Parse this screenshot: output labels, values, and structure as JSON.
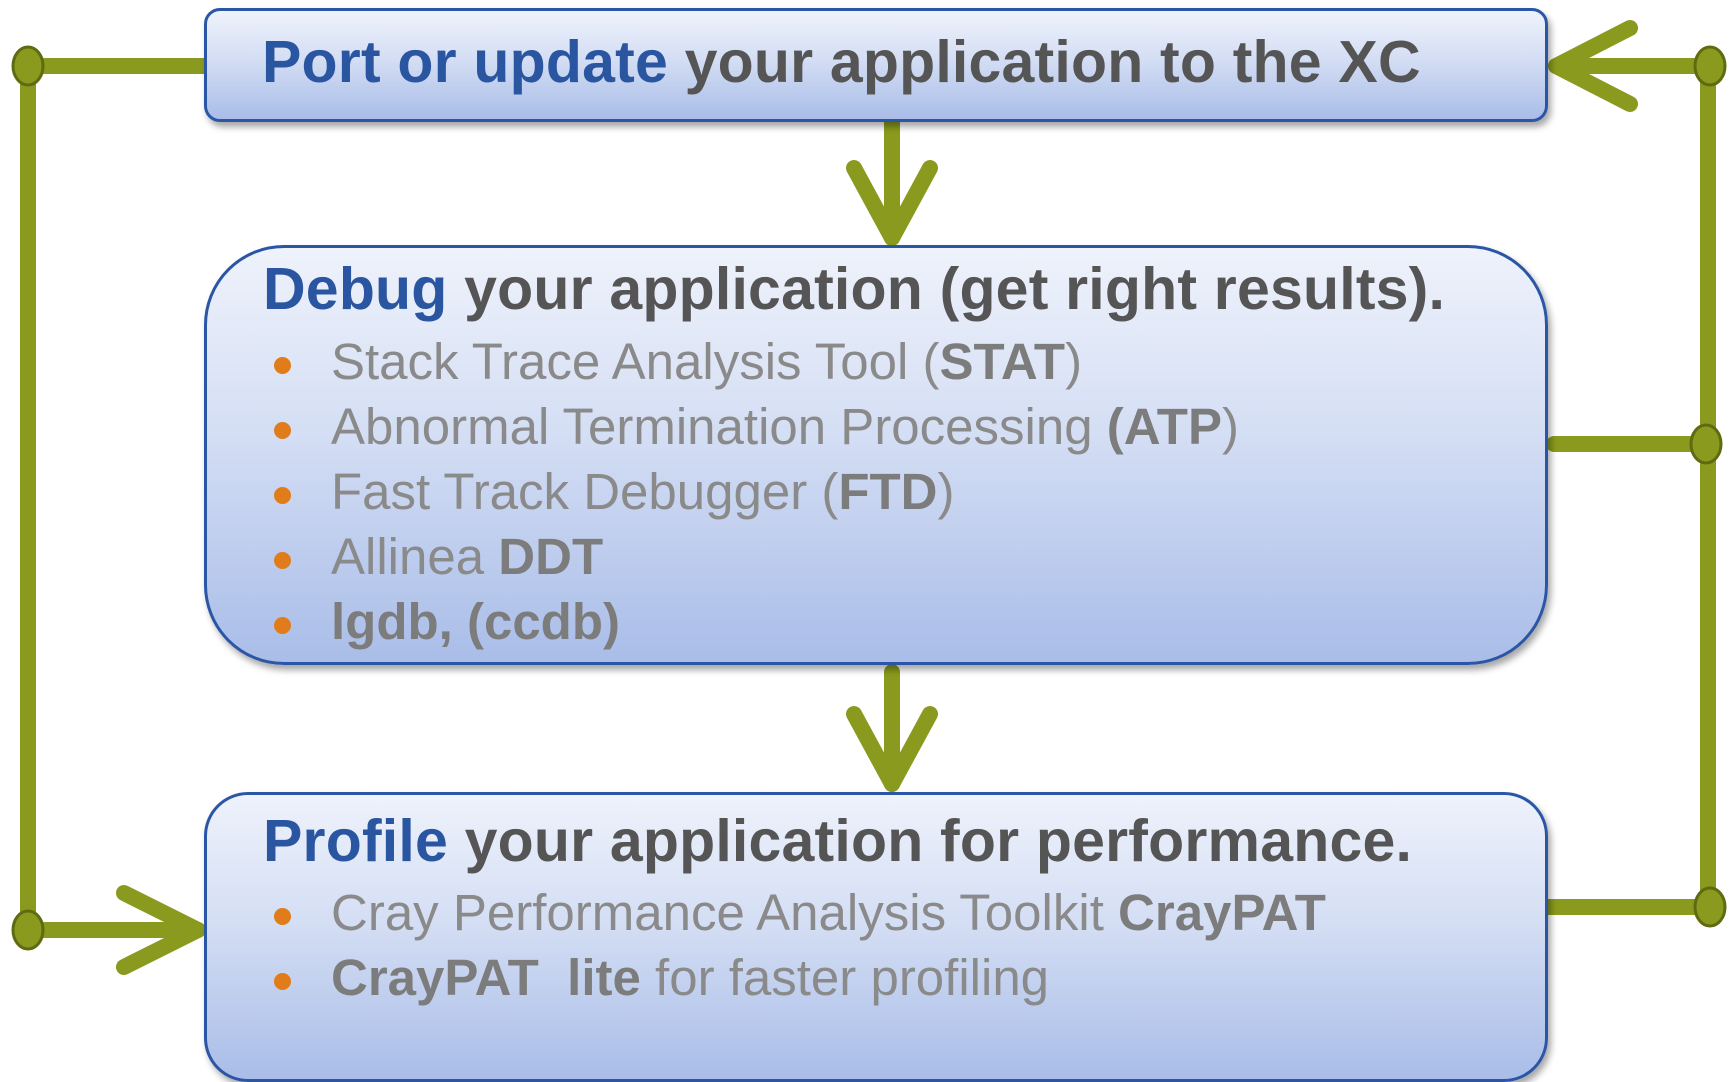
{
  "colors": {
    "arrow": "#8a9a1e",
    "box_border": "#2b56a6",
    "keyword": "#2a55a0",
    "title_text": "#555555",
    "item_text": "#8a8a8a",
    "bullet": "#e07c1a"
  },
  "port_box": {
    "keyword": "Port or update",
    "rest": " your application to the XC"
  },
  "debug_box": {
    "keyword": "Debug",
    "rest": " your application (get right results).",
    "items": [
      {
        "pre": "Stack Trace Analysis Tool (",
        "bold": "STAT",
        "post": ")"
      },
      {
        "pre": "Abnormal Termination Processing ",
        "bold": "(ATP",
        "post": ")"
      },
      {
        "pre": "Fast Track Debugger (",
        "bold": "FTD",
        "post": ")"
      },
      {
        "pre": "Allinea ",
        "bold": "DDT",
        "post": ""
      },
      {
        "pre": "",
        "bold": "lgdb, (ccdb)",
        "post": ""
      }
    ]
  },
  "profile_box": {
    "keyword": "Profile",
    "rest": " your application for performance.",
    "items": [
      {
        "pre": "Cray Performance Analysis Toolkit ",
        "bold": "CrayPAT",
        "post": ""
      },
      {
        "pre": "",
        "bold": "CrayPAT  lite",
        "post": " for faster profiling"
      }
    ]
  }
}
